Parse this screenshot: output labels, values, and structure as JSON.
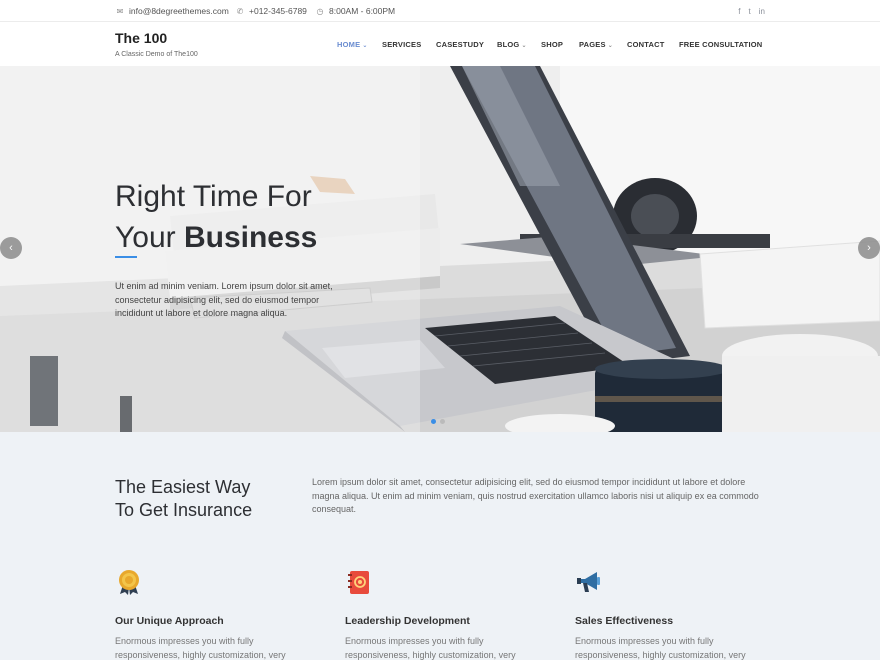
{
  "topbar": {
    "email": "info@8degreethemes.com",
    "phone": "+012-345-6789",
    "hours": "8:00AM - 6:00PM",
    "email_icon": "envelope-icon",
    "phone_icon": "phone-icon",
    "hours_icon": "clock-icon",
    "social": [
      {
        "icon": "facebook-icon",
        "glyph": "f"
      },
      {
        "icon": "twitter-icon",
        "glyph": "t"
      },
      {
        "icon": "linkedin-icon",
        "glyph": "in"
      }
    ]
  },
  "header": {
    "site_title": "The 100",
    "tagline": "A Classic Demo of The100"
  },
  "nav": {
    "items": [
      {
        "label": "HOME",
        "dropdown": true,
        "active": true
      },
      {
        "label": "SERVICES",
        "dropdown": false
      },
      {
        "label": "CASESTUDY",
        "dropdown": false
      },
      {
        "label": "BLOG",
        "dropdown": true
      },
      {
        "label": "SHOP",
        "dropdown": false
      },
      {
        "label": "PAGES",
        "dropdown": true
      },
      {
        "label": "CONTACT",
        "dropdown": false
      },
      {
        "label": "FREE CONSULTATION",
        "dropdown": false
      }
    ],
    "caret": "⌄"
  },
  "hero": {
    "title_line1": "Right Time For",
    "title_line2_regular": "Your ",
    "title_line2_bold": "Business",
    "text": "Ut enim ad minim veniam. Lorem ipsum dolor sit amet, consectetur adipisicing elit, sed do eiusmod tempor incididunt ut labore et dolore magna aliqua.",
    "prev_glyph": "‹",
    "next_glyph": "›",
    "slides": 2,
    "active_slide": 1
  },
  "intro": {
    "title_line1": "The Easiest Way",
    "title_line2": "To Get Insurance",
    "text": "Lorem ipsum dolor sit amet, consectetur adipisicing elit, sed do eiusmod tempor incididunt ut labore et dolore magna aliqua. Ut enim ad minim veniam, quis nostrud exercitation ullamco laboris nisi ut aliquip ex ea commodo consequat."
  },
  "features": [
    {
      "icon": "award-badge-icon",
      "title": "Our Unique Approach",
      "text": "Enormous impresses you with fully responsiveness, highly customization, very"
    },
    {
      "icon": "address-book-icon",
      "title": "Leadership Development",
      "text": "Enormous impresses you with fully responsiveness, highly customization, very"
    },
    {
      "icon": "megaphone-icon",
      "title": "Sales Effectiveness",
      "text": "Enormous impresses you with fully responsiveness, highly customization, very"
    }
  ],
  "colors": {
    "accent": "#3a8ee6",
    "nav_active": "#6a8cd0",
    "section_bg": "#eef2f6"
  }
}
